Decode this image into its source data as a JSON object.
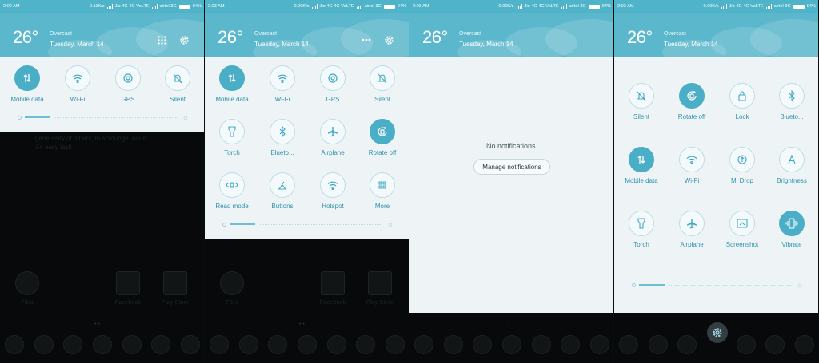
{
  "panels": [
    {
      "status": {
        "time": "2:02 AM",
        "speed": "0.11K/s",
        "carrier1": "Jio 4G 4G VoLTE",
        "carrier2": "airtel 3G",
        "battery": "94%"
      },
      "weather": {
        "temp": "26°",
        "condition": "Overcast",
        "date": "Tuesday, March 14"
      },
      "tiles": [
        {
          "label": "Mobile data",
          "icon": "mobile-data-icon",
          "active": true
        },
        {
          "label": "Wi-Fi",
          "icon": "wifi-icon",
          "active": false
        },
        {
          "label": "GPS",
          "icon": "gps-icon",
          "active": false
        },
        {
          "label": "Silent",
          "icon": "silent-icon",
          "active": false
        }
      ],
      "home": {
        "hint_line1": "generosity of others; to scrounge. noun:",
        "hint_line2": "An easy task",
        "apps": [
          "Files",
          "Facebook",
          "Play Store"
        ]
      }
    },
    {
      "status": {
        "time": "2:03 AM",
        "speed": "0.00K/s",
        "carrier1": "Jio 4G 4G VoLTE",
        "carrier2": "airtel 3G",
        "battery": "94%"
      },
      "weather": {
        "temp": "26°",
        "condition": "Overcast",
        "date": "Tuesday, March 14"
      },
      "tiles": [
        {
          "label": "Mobile data",
          "icon": "mobile-data-icon",
          "active": true
        },
        {
          "label": "Wi-Fi",
          "icon": "wifi-icon",
          "active": false
        },
        {
          "label": "GPS",
          "icon": "gps-icon",
          "active": false
        },
        {
          "label": "Silent",
          "icon": "silent-icon",
          "active": false
        },
        {
          "label": "Torch",
          "icon": "torch-icon",
          "active": false
        },
        {
          "label": "Blueto...",
          "icon": "bluetooth-icon",
          "active": false
        },
        {
          "label": "Airplane",
          "icon": "airplane-icon",
          "active": false
        },
        {
          "label": "Rotate off",
          "icon": "rotate-icon",
          "active": true
        },
        {
          "label": "Read mode",
          "icon": "eye-icon",
          "active": false
        },
        {
          "label": "Buttons",
          "icon": "buttons-icon",
          "active": false
        },
        {
          "label": "Hotspot",
          "icon": "hotspot-icon",
          "active": false
        },
        {
          "label": "More",
          "icon": "more-icon",
          "active": false
        }
      ],
      "home": {
        "apps": [
          "Files",
          "Facebook",
          "Play Store"
        ]
      }
    },
    {
      "status": {
        "time": "2:03 AM",
        "speed": "0.00K/s",
        "carrier1": "Jio 4G 4G VoLTE",
        "carrier2": "airtel 3G",
        "battery": "94%"
      },
      "weather": {
        "temp": "26°",
        "condition": "Overcast",
        "date": "Tuesday, March 14"
      },
      "notifications": {
        "empty_text": "No notifications.",
        "manage_label": "Manage notifications"
      }
    },
    {
      "status": {
        "time": "2:03 AM",
        "speed": "0.00K/s",
        "carrier1": "Jio 4G 4G VoLTE",
        "carrier2": "airtel 3G",
        "battery": "94%"
      },
      "weather": {
        "temp": "26°",
        "condition": "Overcast",
        "date": "Tuesday, March 14"
      },
      "tiles": [
        {
          "label": "Silent",
          "icon": "silent-icon",
          "active": false
        },
        {
          "label": "Rotate off",
          "icon": "rotate-icon",
          "active": true
        },
        {
          "label": "Lock",
          "icon": "lock-icon",
          "active": false
        },
        {
          "label": "Blueto...",
          "icon": "bluetooth-icon",
          "active": false
        },
        {
          "label": "Mobile data",
          "icon": "mobile-data-icon",
          "active": true
        },
        {
          "label": "Wi-Fi",
          "icon": "wifi-icon",
          "active": false
        },
        {
          "label": "Mi Drop",
          "icon": "mi-drop-icon",
          "active": false
        },
        {
          "label": "Brightness",
          "icon": "brightness-icon",
          "active": false
        },
        {
          "label": "Torch",
          "icon": "torch-icon",
          "active": false
        },
        {
          "label": "Airplane",
          "icon": "airplane-icon",
          "active": false
        },
        {
          "label": "Screenshot",
          "icon": "screenshot-icon",
          "active": false
        },
        {
          "label": "Vibrate",
          "icon": "vibrate-icon",
          "active": true
        }
      ]
    }
  ]
}
